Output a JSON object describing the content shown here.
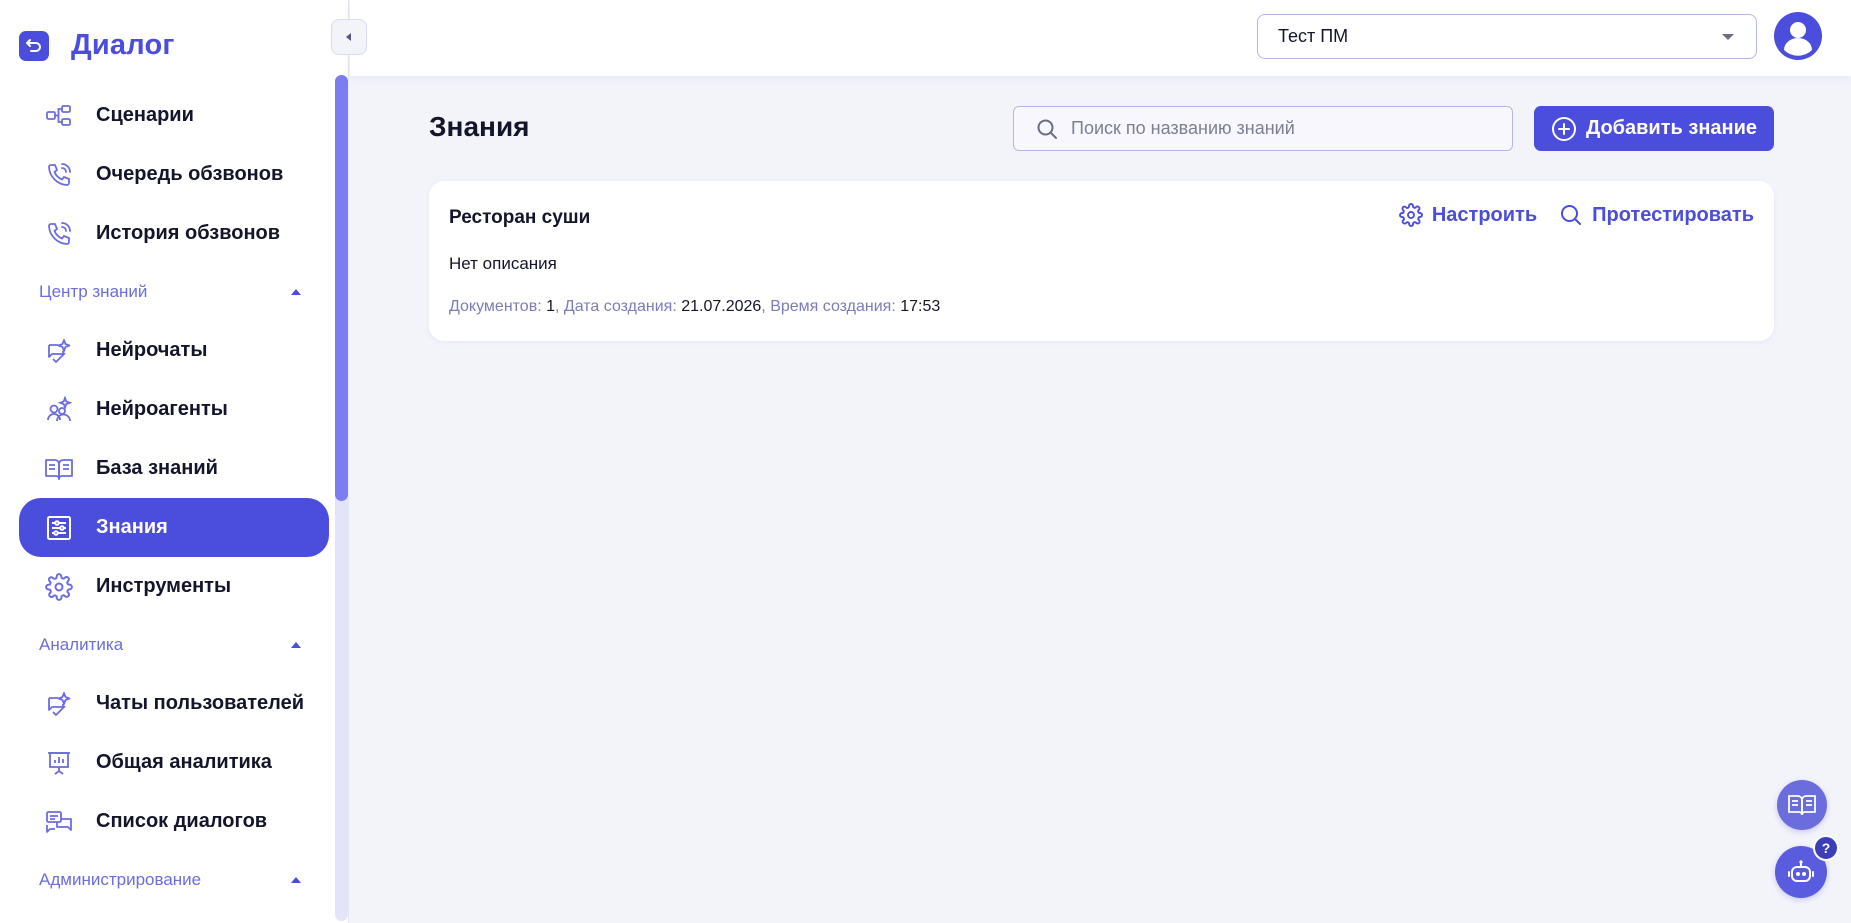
{
  "app": {
    "name": "Диалог"
  },
  "sidebar": {
    "items": [
      {
        "label": "Сценарии",
        "icon": "flow-icon"
      },
      {
        "label": "Очередь обзвонов",
        "icon": "phone-call-icon"
      },
      {
        "label": "История обзвонов",
        "icon": "phone-call-icon"
      }
    ],
    "knowledge_section": {
      "label": "Центр знаний",
      "expanded": true
    },
    "knowledge_items": [
      {
        "label": "Нейрочаты",
        "icon": "sparkle-chat-icon"
      },
      {
        "label": "Нейроагенты",
        "icon": "sparkle-users-icon"
      },
      {
        "label": "База знаний",
        "icon": "book-icon"
      },
      {
        "label": "Знания",
        "icon": "sliders-icon",
        "active": true
      },
      {
        "label": "Инструменты",
        "icon": "gear-icon"
      }
    ],
    "analytics_section": {
      "label": "Аналитика",
      "expanded": true
    },
    "analytics_items": [
      {
        "label": "Чаты пользователей",
        "icon": "sparkle-chat-icon"
      },
      {
        "label": "Общая аналитика",
        "icon": "presentation-icon"
      },
      {
        "label": "Список диалогов",
        "icon": "dialogs-icon"
      }
    ],
    "admin_section": {
      "label": "Администрирование",
      "expanded": true
    }
  },
  "header": {
    "project_select": {
      "value": "Тест ПМ"
    }
  },
  "main": {
    "title": "Знания",
    "search": {
      "placeholder": "Поиск по названию знаний"
    },
    "add_button": "Добавить знание",
    "cards": [
      {
        "title": "Ресторан суши",
        "description": "Нет описания",
        "docs_label": "Документов:",
        "docs_value": "1",
        "date_label": "Дата создания:",
        "date_value": "21.07.2026",
        "time_label": "Время создания:",
        "time_value": "17:53",
        "configure_label": "Настроить",
        "test_label": "Протестировать"
      }
    ]
  },
  "colors": {
    "accent": "#4b4ddd",
    "background": "#f3f4fa",
    "muted": "#7b7cb8"
  }
}
